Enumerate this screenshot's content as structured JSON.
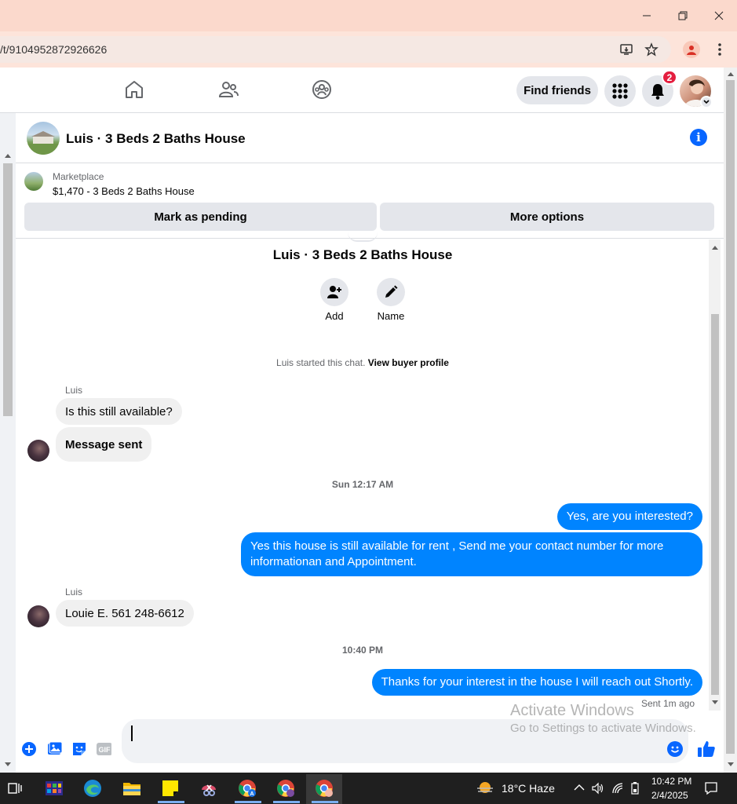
{
  "browser": {
    "url": "/t/9104952872926626",
    "notification_count": "2"
  },
  "fb_header": {
    "find_friends_label": "Find friends",
    "notification_badge": "2"
  },
  "chat": {
    "title": "Luis · 3 Beds 2 Baths House",
    "marketplace": {
      "label": "Marketplace",
      "listing": "$1,470 - 3 Beds 2 Baths House",
      "mark_pending_label": "Mark as pending",
      "more_options_label": "More options"
    },
    "conversation_title": "Luis · 3 Beds 2 Baths House",
    "actions": [
      {
        "label": "Add",
        "icon": "add-person-icon"
      },
      {
        "label": "Name",
        "icon": "pencil-icon"
      }
    ],
    "started_text": "Luis started this chat.",
    "view_profile_link": "View buyer profile",
    "messages": [
      {
        "sender": "Luis",
        "direction": "in",
        "text": "Is this still available?"
      },
      {
        "direction": "in",
        "text": "Message sent"
      },
      {
        "timestamp": "Sun 12:17 AM"
      },
      {
        "direction": "out",
        "text": "Yes, are you interested?"
      },
      {
        "direction": "out",
        "text": "Yes this house is still available for rent , Send me your contact number for more informationan and Appointment."
      },
      {
        "sender": "Luis",
        "direction": "in",
        "text": "Louie E.  561 248-6612"
      },
      {
        "timestamp": "10:40 PM"
      },
      {
        "direction": "out",
        "text": "Thanks for your interest in the house I will reach out Shortly."
      }
    ],
    "sent_status": "Sent 1m ago",
    "composer_value": ""
  },
  "watermark": {
    "line1": "Activate Windows",
    "line2": "Go to Settings to activate Windows."
  },
  "taskbar": {
    "weather": "18°C  Haze",
    "time": "10:42 PM",
    "date": "2/4/2025"
  },
  "colors": {
    "messenger_blue": "#0084ff",
    "fb_blue": "#0866ff",
    "badge_red": "#e41e3f",
    "browser_chrome": "#fbd9cc"
  }
}
